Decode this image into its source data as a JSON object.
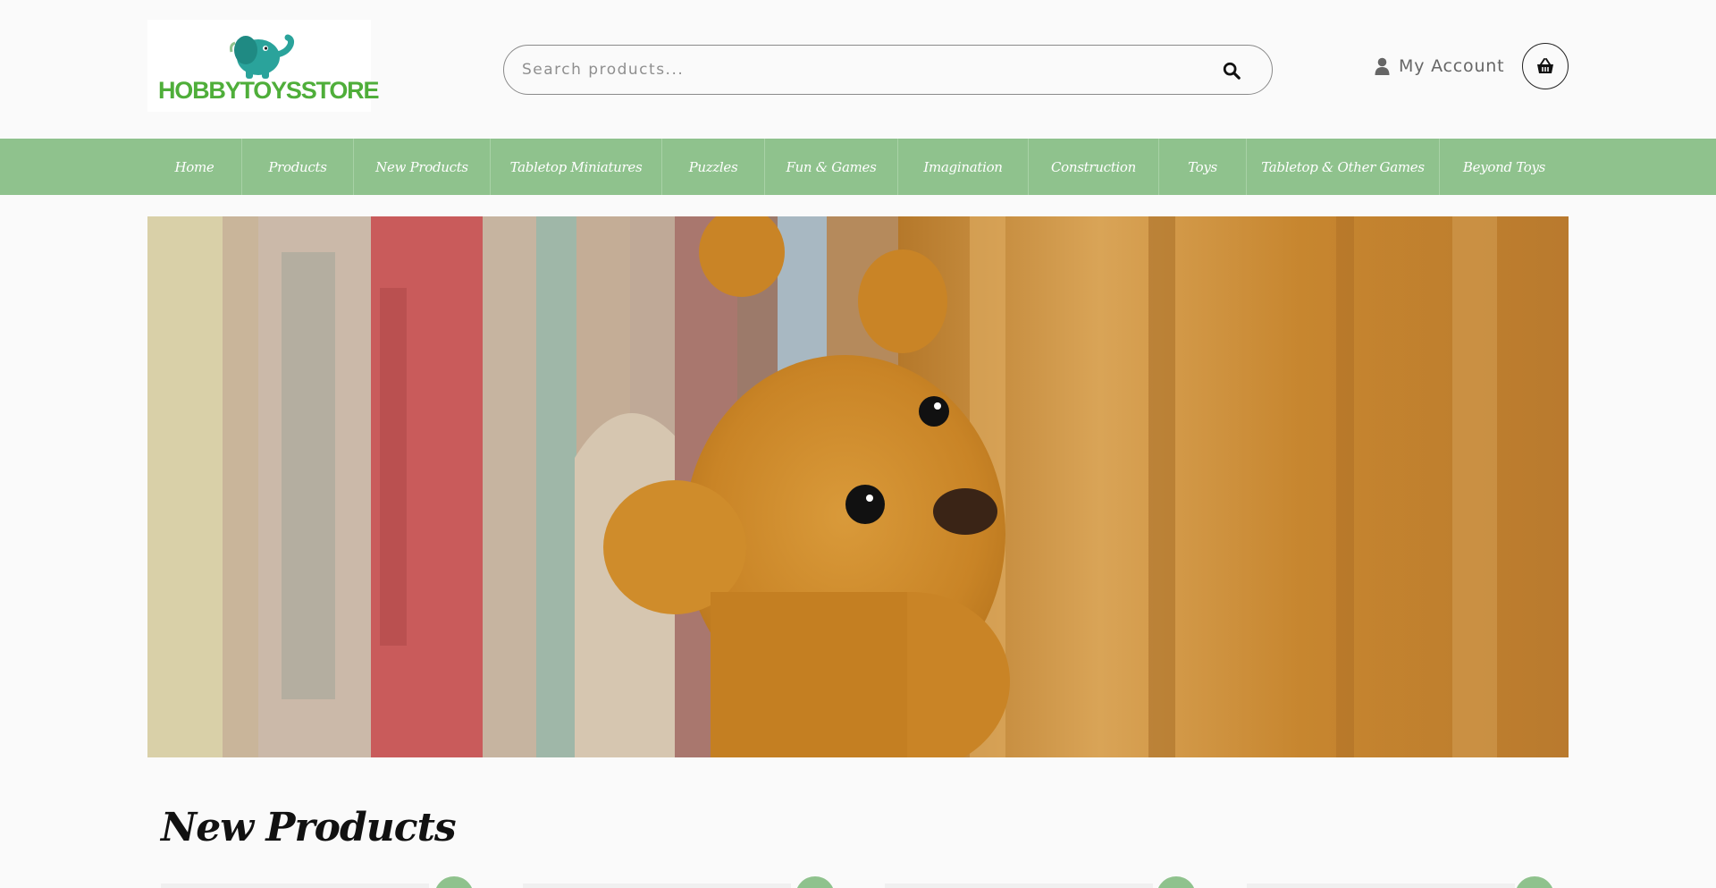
{
  "header": {
    "logo_text": "HOBBYTOYSSTORE",
    "search_placeholder": "Search products...",
    "account_label": "My Account"
  },
  "nav": {
    "items": [
      {
        "label": "Home"
      },
      {
        "label": "Products"
      },
      {
        "label": "New Products"
      },
      {
        "label": "Tabletop Miniatures"
      },
      {
        "label": "Puzzles"
      },
      {
        "label": "Fun & Games"
      },
      {
        "label": "Imagination"
      },
      {
        "label": "Construction"
      },
      {
        "label": "Toys"
      },
      {
        "label": "Tabletop & Other Games"
      },
      {
        "label": "Beyond Toys"
      }
    ]
  },
  "section": {
    "title": "New Products"
  },
  "colors": {
    "accent": "#8fc28d",
    "logo_green": "#4fae3a",
    "elephant": "#2aa39b"
  },
  "icons": [
    "elephant-logo-icon",
    "search-icon",
    "user-icon",
    "basket-icon"
  ]
}
